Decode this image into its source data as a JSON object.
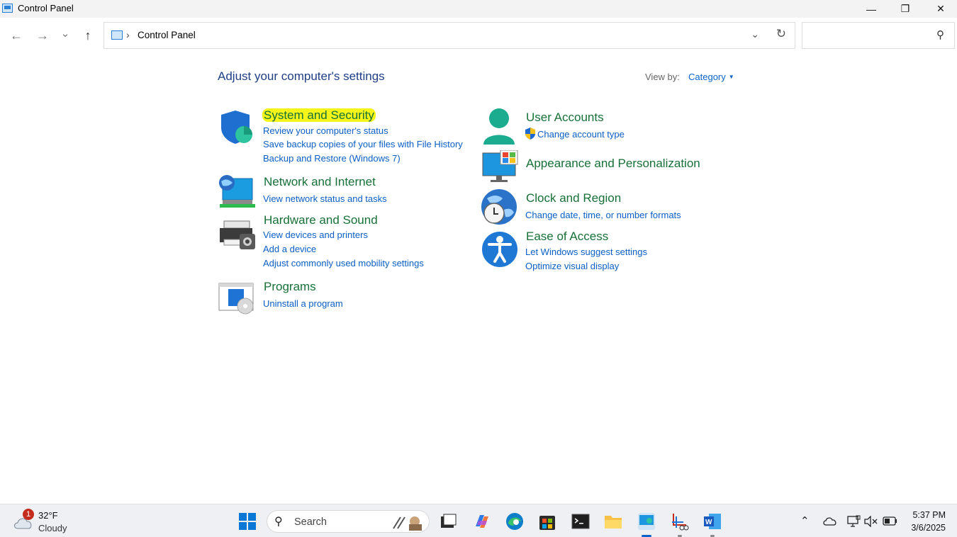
{
  "window": {
    "title": "Control Panel",
    "minimize_glyph": "—",
    "restore_glyph": "❐",
    "close_glyph": "✕"
  },
  "nav": {
    "back_glyph": "←",
    "forward_glyph": "→",
    "recent_glyph": "⌄",
    "up_glyph": "↑",
    "breadcrumb_sep": "›",
    "breadcrumb": "Control Panel",
    "dropdown_glyph": "⌄",
    "refresh_glyph": "↻",
    "search_placeholder": "",
    "search_glyph": "⚲"
  },
  "content": {
    "heading": "Adjust your computer's settings",
    "view_by_label": "View by:",
    "view_by_value": "Category",
    "left": [
      {
        "title": "System and Security",
        "icon": "shield-icon",
        "links": [
          "Review your computer's status",
          "Save backup copies of your files with File History",
          "Backup and Restore (Windows 7)"
        ]
      },
      {
        "title": "Network and Internet",
        "icon": "network-icon",
        "links": [
          "View network status and tasks"
        ]
      },
      {
        "title": "Hardware and Sound",
        "icon": "printer-icon",
        "links": [
          "View devices and printers",
          "Add a device",
          "Adjust commonly used mobility settings"
        ]
      },
      {
        "title": "Programs",
        "icon": "programs-icon",
        "links": [
          "Uninstall a program"
        ]
      }
    ],
    "right": [
      {
        "title": "User Accounts",
        "icon": "user-icon",
        "links": [
          "Change account type"
        ]
      },
      {
        "title": "Appearance and Personalization",
        "icon": "monitor-icon",
        "links": []
      },
      {
        "title": "Clock and Region",
        "icon": "clock-globe-icon",
        "links": [
          "Change date, time, or number formats"
        ]
      },
      {
        "title": "Ease of Access",
        "icon": "accessibility-icon",
        "links": [
          "Let Windows suggest settings",
          "Optimize visual display"
        ]
      }
    ]
  },
  "taskbar": {
    "weather_temp": "32°F",
    "weather_cond": "Cloudy",
    "weather_badge": "1",
    "search_text": "Search",
    "time": "5:37 PM",
    "date": "3/6/2025",
    "colors": {
      "accent": "#0a63c9",
      "green_title": "#177037",
      "link": "#0b5fc5",
      "highlight": "#f5f51a"
    }
  }
}
